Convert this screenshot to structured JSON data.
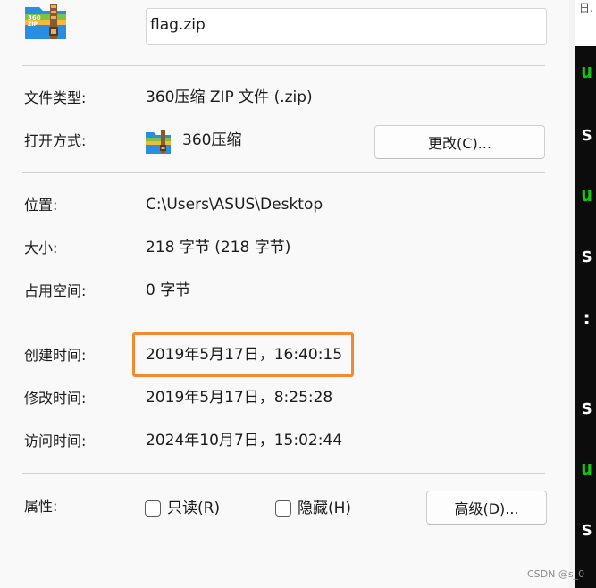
{
  "file_name": "flag.zip",
  "props": {
    "type_label": "文件类型:",
    "type_value": "360压缩 ZIP 文件 (.zip)",
    "open_label": "打开方式:",
    "open_value": "360压缩",
    "change_button": "更改(C)...",
    "location_label": "位置:",
    "location_value": "C:\\Users\\ASUS\\Desktop",
    "size_label": "大小:",
    "size_value": "218 字节 (218 字节)",
    "disk_size_label": "占用空间:",
    "disk_size_value": "0 字节",
    "created_label": "创建时间:",
    "created_value": "2019年5月17日，16:40:15",
    "modified_label": "修改时间:",
    "modified_value": "2019年5月17日，8:25:28",
    "accessed_label": "访问时间:",
    "accessed_value": "2024年10月7日，15:02:44",
    "attributes_label": "属性:",
    "readonly_label": "只读(R)",
    "hidden_label": "隐藏(H)",
    "advanced_button": "高级(D)..."
  },
  "terminal": {
    "top_glyph": "日.",
    "chars": [
      "u",
      "s",
      "u",
      "s",
      ":",
      "s",
      "u",
      "s"
    ],
    "colors": {
      "u": "#16c60c",
      "s": "#ffffff",
      ":": "#ffffff"
    }
  },
  "icons": {
    "archive": "archive-360zip-icon",
    "app": "360zip-app-icon"
  },
  "watermark": "CSDN @s_0",
  "colors": {
    "highlight": "#f28a30",
    "terminal_bg": "#0c0c0c",
    "terminal_green": "#16c60c"
  }
}
